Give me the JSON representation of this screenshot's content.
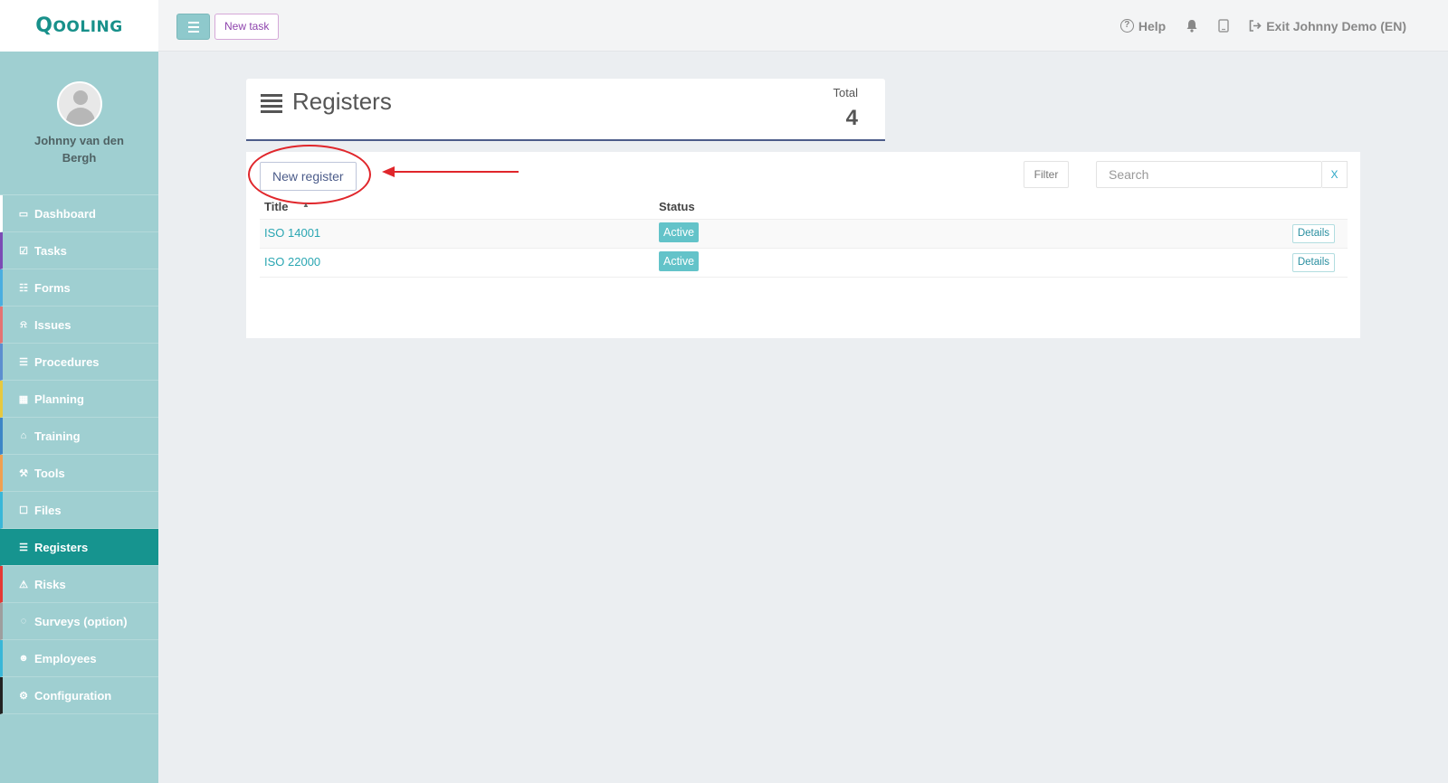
{
  "app": {
    "logo": "Qooling"
  },
  "topbar": {
    "new_task_label": "New task",
    "help_label": "Help",
    "exit_label": "Exit Johnny Demo (EN)"
  },
  "user": {
    "name": "Johnny van den Bergh"
  },
  "sidebar": {
    "items": [
      {
        "label": "Dashboard",
        "icon": "monitor-icon",
        "accent": "#ffffff"
      },
      {
        "label": "Tasks",
        "icon": "check-square-icon",
        "accent": "#7b4bb5"
      },
      {
        "label": "Forms",
        "icon": "document-icon",
        "accent": "#4aaee0"
      },
      {
        "label": "Issues",
        "icon": "bell-icon",
        "accent": "#e57373"
      },
      {
        "label": "Procedures",
        "icon": "list-icon",
        "accent": "#5c8ecf"
      },
      {
        "label": "Planning",
        "icon": "calendar-icon",
        "accent": "#e8c93e"
      },
      {
        "label": "Training",
        "icon": "graduation-cap-icon",
        "accent": "#3d86c6"
      },
      {
        "label": "Tools",
        "icon": "wrench-icon",
        "accent": "#f0a050"
      },
      {
        "label": "Files",
        "icon": "file-icon",
        "accent": "#39b7d8"
      },
      {
        "label": "Registers",
        "icon": "list-icon",
        "accent": "#16948f"
      },
      {
        "label": "Risks",
        "icon": "warning-icon",
        "accent": "#e53935"
      },
      {
        "label": "Surveys (option)",
        "icon": "comment-icon",
        "accent": "#9e9e9e"
      },
      {
        "label": "Employees",
        "icon": "users-icon",
        "accent": "#39b7d8"
      },
      {
        "label": "Configuration",
        "icon": "gear-icon",
        "accent": "#222222"
      }
    ],
    "active": "Registers"
  },
  "page": {
    "title": "Registers",
    "total_label": "Total",
    "total_value": "4"
  },
  "toolbar": {
    "new_register_label": "New register",
    "filter_label": "Filter",
    "search_placeholder": "Search",
    "clear_label": "X"
  },
  "table": {
    "columns": [
      "Title",
      "Status"
    ],
    "rows": [
      {
        "title": "ISO 14001",
        "status": "Active",
        "action": "Details"
      },
      {
        "title": "ISO 22000",
        "status": "Active",
        "action": "Details"
      }
    ]
  },
  "colors": {
    "brand": "#18908a",
    "sidebar_bg": "#9fcfd1",
    "active_item": "#16948f",
    "annotation": "#e0262b"
  }
}
